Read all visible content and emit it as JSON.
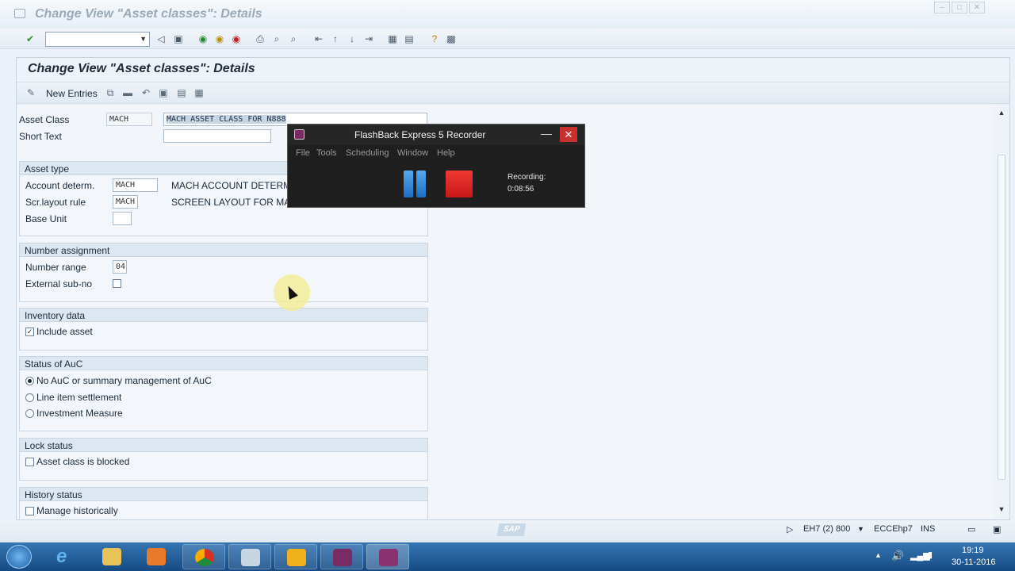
{
  "window": {
    "title": "Change View \"Asset classes\": Details",
    "controls": [
      "–",
      "□",
      "✕"
    ]
  },
  "toolbar": {
    "command_field": "",
    "icons": [
      "enter-icon",
      "back-icon",
      "save-icon",
      "green-back-icon",
      "exit-icon",
      "cancel-icon",
      "print-icon",
      "find-icon",
      "find-next-icon",
      "first-page-icon",
      "prev-page-icon",
      "next-page-icon",
      "last-page-icon",
      "create-session-icon",
      "shortcut-icon",
      "help-icon",
      "customize-icon"
    ]
  },
  "page": {
    "title": "Change View \"Asset classes\": Details",
    "new_entries_label": "New Entries"
  },
  "header_fields": {
    "asset_class_label": "Asset Class",
    "asset_class_value": "MACH",
    "asset_class_desc": "MACH ASSET CLASS FOR N888",
    "short_text_label": "Short Text",
    "short_text_value": ""
  },
  "asset_type": {
    "title": "Asset type",
    "account_determ_label": "Account determ.",
    "account_determ_value": "MACH",
    "account_determ_desc": "MACH ACCOUNT DETERMINA",
    "scr_layout_label": "Scr.layout rule",
    "scr_layout_value": "MACH",
    "scr_layout_desc": "SCREEN LAYOUT FOR MACH",
    "base_unit_label": "Base Unit",
    "base_unit_value": ""
  },
  "number_assignment": {
    "title": "Number assignment",
    "number_range_label": "Number range",
    "number_range_value": "04",
    "external_subno_label": "External sub-no",
    "external_subno_checked": false
  },
  "inventory_data": {
    "title": "Inventory data",
    "include_asset_label": "Include asset",
    "include_asset_checked": true,
    "check_mark": "✓"
  },
  "status_auc": {
    "title": "Status of AuC",
    "options": [
      "No AuC or summary management of AuC",
      "Line item settlement",
      "Investment Measure"
    ],
    "selected": 0
  },
  "lock_status": {
    "title": "Lock status",
    "blocked_label": "Asset class is blocked",
    "blocked_checked": false
  },
  "history_status": {
    "title": "History status",
    "manage_label": "Manage historically",
    "manage_checked": false
  },
  "status_bar": {
    "sap_logo": "SAP",
    "system": "EH7 (2) 800",
    "server": "ECCEhp7",
    "mode": "INS"
  },
  "recorder": {
    "title": "FlashBack Express 5 Recorder",
    "menu": [
      "File",
      "Tools",
      "Scheduling",
      "Window",
      "Help"
    ],
    "status_label": "Recording:",
    "elapsed": "0:08:56",
    "minimize": "—",
    "close": "✕"
  },
  "taskbar": {
    "apps": [
      "start-button",
      "internet-explorer",
      "file-explorer",
      "media-player",
      "chrome",
      "sap-logon",
      "sap-gui",
      "flashback-recorder",
      "flashback-player"
    ],
    "time": "19:19",
    "date": "30-11-2016"
  },
  "colors": {
    "accent_blue": "#1c6fc4",
    "record_red": "#c7171a",
    "taskbar": "#164a84"
  }
}
